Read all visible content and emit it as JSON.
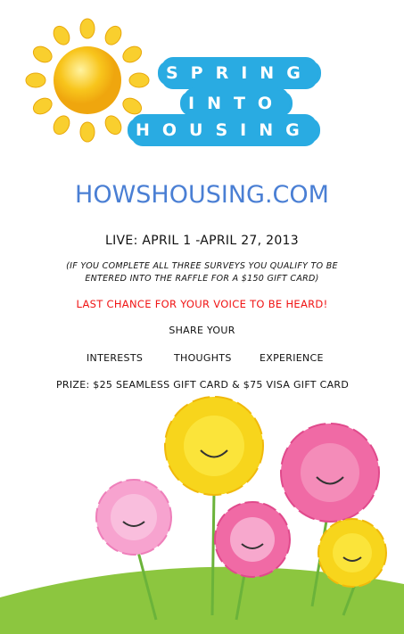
{
  "title": {
    "line1": "SPRING",
    "line2": "INTO",
    "line3": "HOUSING"
  },
  "website": "HOWSHOUSING.COM",
  "dates": "LIVE: APRIL 1 -APRIL 27, 2013",
  "raffle_line1": "(IF YOU COMPLETE ALL THREE SURVEYS YOU QUALIFY TO BE",
  "raffle_line2": "ENTERED INTO THE RAFFLE FOR A $150 GIFT CARD)",
  "last_chance": "LAST CHANCE FOR YOUR VOICE TO BE HEARD!",
  "share": "SHARE YOUR",
  "share_items": [
    "INTERESTS",
    "THOUGHTS",
    "EXPERIENCE"
  ],
  "prize": "PRIZE: $25 SEAMLESS GIFT CARD & $75 VISA GIFT CARD",
  "colors": {
    "blue": "#29abe2",
    "site": "#4a7fd4",
    "red": "#f01414",
    "sun": "#f7c21a",
    "grass": "#8cc63f"
  }
}
